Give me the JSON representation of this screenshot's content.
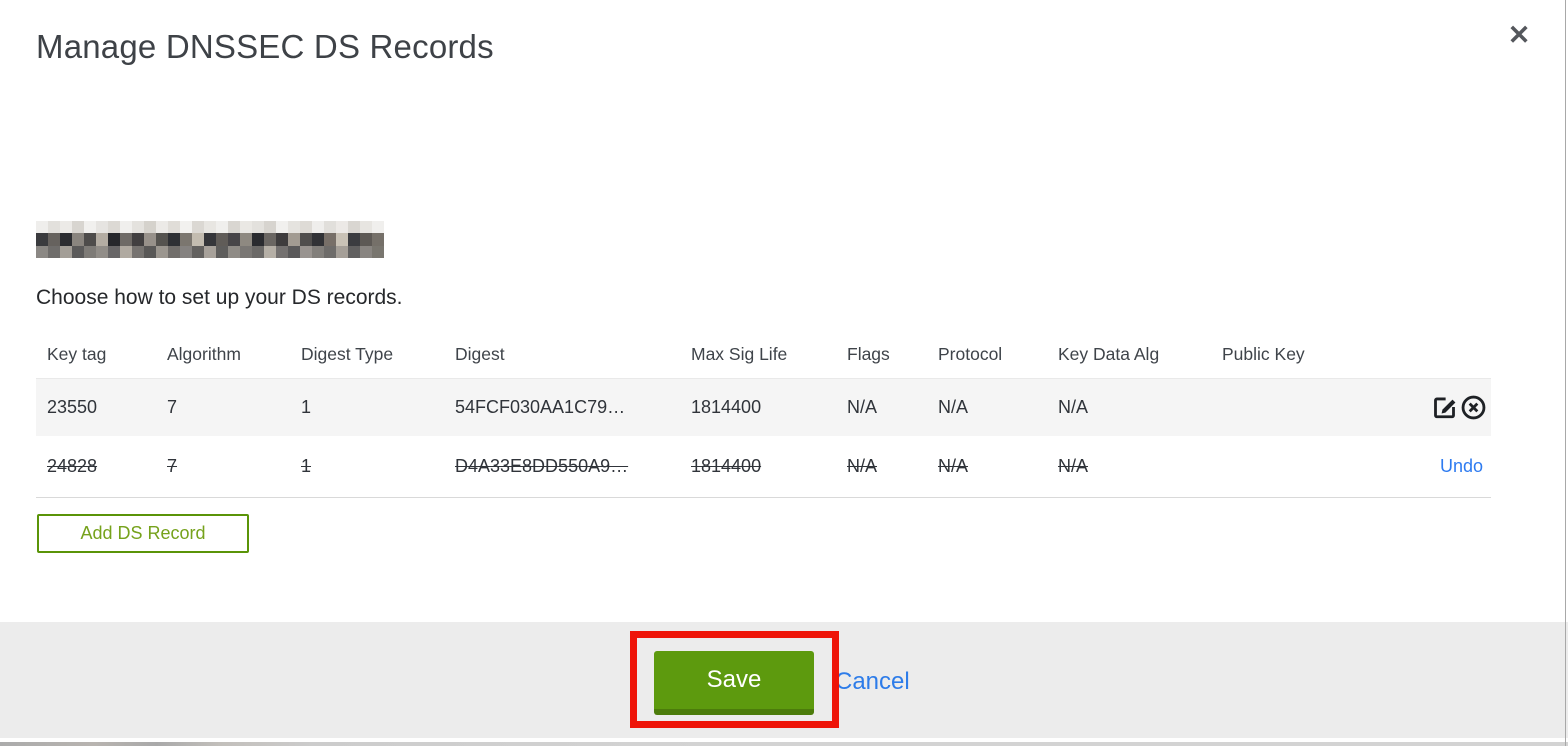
{
  "dialog": {
    "title": "Manage DNSSEC DS Records",
    "close_icon": "✕",
    "intro": "Choose how to set up your DS records."
  },
  "redacted_domain": {
    "description": "pixelated-redacted-domain-name",
    "rows": [
      [
        "#efeeec",
        "#e2e0dc",
        "#eceae7",
        "#d8d5d0",
        "#f1f0ee",
        "#e6e4e1",
        "#dcd9d4",
        "#f0efed",
        "#e4e2de",
        "#d5d2cc",
        "#eceae7",
        "#e0ddd8",
        "#f2f1ef",
        "#dbd8d3",
        "#e8e6e2",
        "#f0efed",
        "#ded BBb6",
        "#eae8e4",
        "#e3e1dd",
        "#d7d4cf",
        "#f1f0ee",
        "#e5e3df",
        "#dedbd6",
        "#efeeec",
        "#e1dfdb",
        "#ece9e6",
        "#d9d6d1",
        "#e7e5e1",
        "#f0efed"
      ],
      [
        "#3a3b3e",
        "#66625e",
        "#2c2d31",
        "#8a857f",
        "#4e4c4b",
        "#b4ada3",
        "#26272b",
        "#6e6a66",
        "#413f40",
        "#97918a",
        "#55534f",
        "#2e3034",
        "#7b766f",
        "#c3bcb0",
        "#35363a",
        "#605c58",
        "#474548",
        "#8e8981",
        "#2a2b2f",
        "#6a6662",
        "#3e3c3d",
        "#a29b92",
        "#504e4d",
        "#313236",
        "#776f68",
        "#c9c2b6",
        "#3b3c40",
        "#5d5955",
        "#757069"
      ],
      [
        "#8b8884",
        "#6f6d6b",
        "#a39e97",
        "#5b5a5a",
        "#7e7b77",
        "#918d88",
        "#686667",
        "#b0aaa1",
        "#767370",
        "#595857",
        "#9b968f",
        "#716e6b",
        "#858280",
        "#63615f",
        "#a7a19a",
        "#5e5d5c",
        "#8f8b86",
        "#7a7774",
        "#6b6967",
        "#b5afa6",
        "#747170",
        "#5a595a",
        "#999490",
        "#827f7b",
        "#6e6c6a",
        "#a59f98",
        "#616060",
        "#898581",
        "#79766f"
      ]
    ]
  },
  "table": {
    "headers": [
      "Key tag",
      "Algorithm",
      "Digest Type",
      "Digest",
      "Max Sig Life",
      "Flags",
      "Protocol",
      "Key Data Alg",
      "Public Key"
    ],
    "rows": [
      {
        "key_tag": "23550",
        "algorithm": "7",
        "digest_type": "1",
        "digest": "54FCF030AA1C79…",
        "max_sig_life": "1814400",
        "flags": "N/A",
        "protocol": "N/A",
        "key_data_alg": "N/A",
        "public_key": "",
        "state": "normal",
        "actions": [
          "edit",
          "delete"
        ]
      },
      {
        "key_tag": "24828",
        "algorithm": "7",
        "digest_type": "1",
        "digest": "D4A33E8DD550A9…",
        "max_sig_life": "1814400",
        "flags": "N/A",
        "protocol": "N/A",
        "key_data_alg": "N/A",
        "public_key": "",
        "state": "deleted",
        "action_label": "Undo"
      }
    ]
  },
  "buttons": {
    "add_ds_record": "Add DS Record",
    "save": "Save",
    "cancel": "Cancel"
  },
  "annotation": {
    "type": "highlight-rectangle",
    "target": "save-button",
    "color": "#ee1509"
  },
  "colors": {
    "save_green": "#5d9a0e",
    "save_green_dark": "#4c7c0b",
    "add_button_green_border": "#5a9408",
    "add_button_green_text": "#76a21c",
    "link_blue": "#2d7ce9",
    "footer_gray": "#ececec",
    "row_gray": "#f5f5f5",
    "title_gray": "#3e4247"
  }
}
